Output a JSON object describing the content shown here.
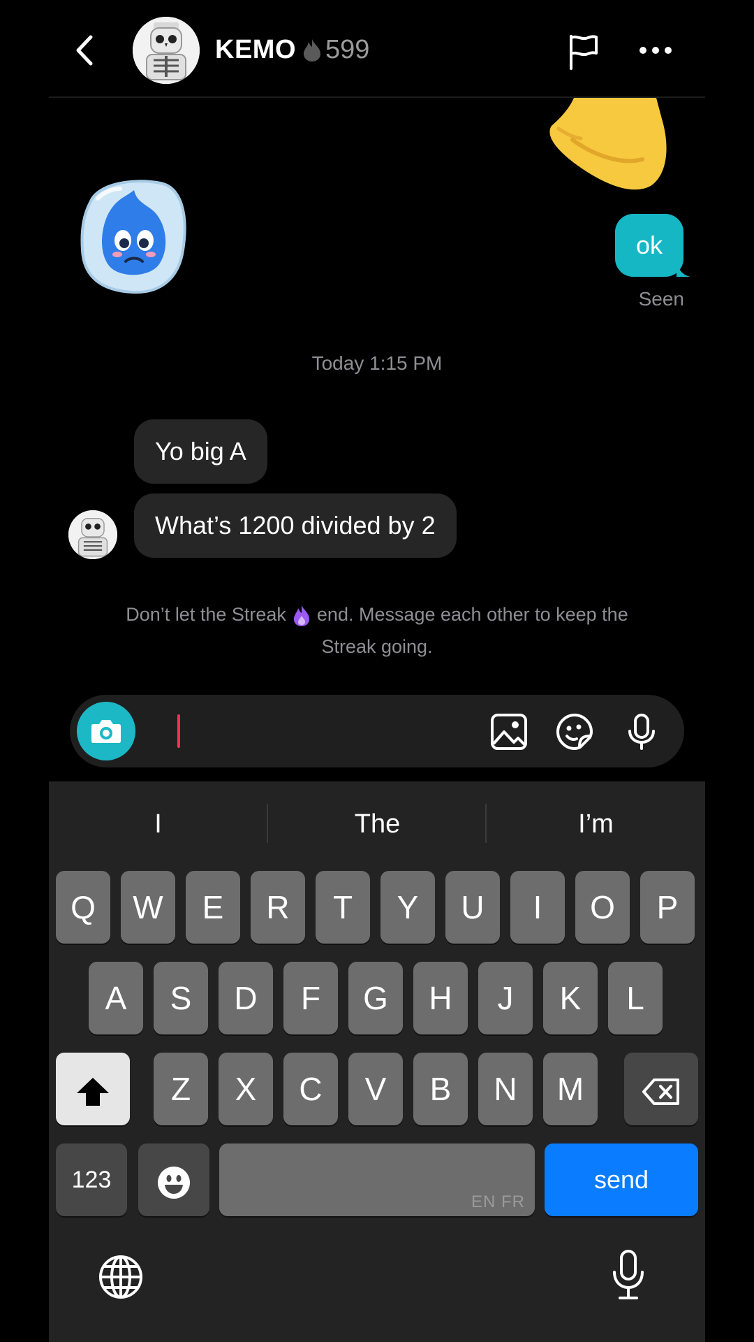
{
  "header": {
    "contact_name": "KEMO",
    "streak_count": "599"
  },
  "chat": {
    "outgoing_message": "ok",
    "seen_label": "Seen",
    "timestamp": "Today 1:15 PM",
    "incoming_messages": [
      "Yo big A",
      "What’s 1200 divided by 2"
    ],
    "streak_tip_before": "Don’t let the Streak",
    "streak_tip_after": "end. Message each other to keep the Streak going."
  },
  "composer": {
    "message_value": "",
    "message_placeholder": ""
  },
  "keyboard": {
    "suggestions": [
      "I",
      "The",
      "I’m"
    ],
    "row1": [
      "Q",
      "W",
      "E",
      "R",
      "T",
      "Y",
      "U",
      "I",
      "O",
      "P"
    ],
    "row2": [
      "A",
      "S",
      "D",
      "F",
      "G",
      "H",
      "J",
      "K",
      "L"
    ],
    "row3": [
      "Z",
      "X",
      "C",
      "V",
      "B",
      "N",
      "M"
    ],
    "numbers_label": "123",
    "language_tag": "EN FR",
    "send_label": "send"
  },
  "colors": {
    "accent_teal": "#16b7c4",
    "send_blue": "#0a7cff",
    "caret_pink": "#ff2d55"
  },
  "icons": [
    "chevron-left-icon",
    "flame-icon",
    "flag-icon",
    "more-icon",
    "camera-icon",
    "image-icon",
    "sticker-icon",
    "microphone-icon",
    "shift-icon",
    "backspace-icon",
    "emoji-icon",
    "globe-icon"
  ]
}
